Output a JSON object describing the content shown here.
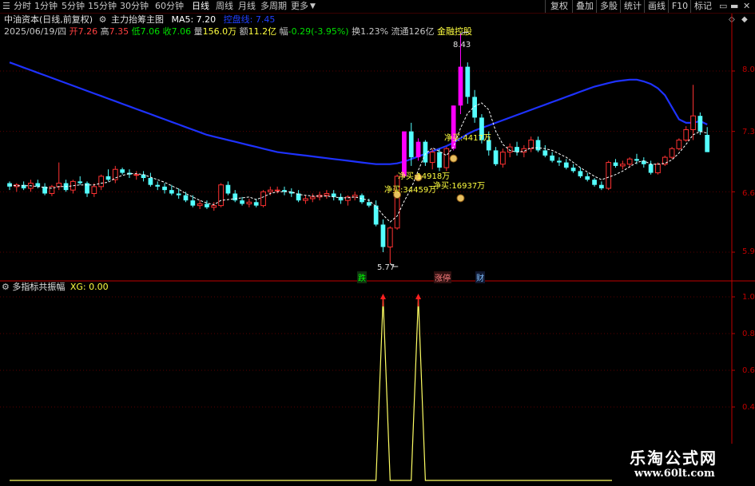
{
  "toolbar": {
    "menu_icon": "menu-icon",
    "periods": [
      "分时",
      "1分钟",
      "5分钟",
      "15分钟",
      "30分钟",
      "60分钟",
      "日线",
      "周线",
      "月线",
      "多周期",
      "更多"
    ],
    "active_period": "日线",
    "more_arrow": "chevron-down-icon",
    "right_buttons": [
      "复权",
      "叠加",
      "多股",
      "统计",
      "画线",
      "F10",
      "标记"
    ],
    "right_icons": [
      "layout-icon",
      "minimize-icon",
      "close-icon"
    ]
  },
  "info": {
    "stock_title": "中油资本(日线,前复权)",
    "indicator_name": "主力抬筹主图",
    "ma_label": "MA5: 7.20",
    "ma_hidden": "控盘线: 7.45",
    "date": "2025/06/19/四",
    "open_label": "开",
    "open_val": "7.26",
    "high_label": "高",
    "high_val": "7.35",
    "low_label": "低",
    "low_val": "7.06",
    "close_label": "收",
    "close_val": "7.06",
    "vol_label": "量",
    "vol_val": "156.0万",
    "amt_label": "额",
    "amt_val": "11.2亿",
    "chg_label": "幅",
    "chg_val": "-0.29(-3.95%)",
    "turn_label": "换",
    "turn_val": "1.23%",
    "float_label": "流通",
    "float_val": "126亿",
    "tag": "金融控股"
  },
  "main_axis": [
    "8.0",
    "7.3",
    "6.6",
    "5.9"
  ],
  "sub_axis": [
    "1.0",
    "0.80",
    "0.60",
    "0.40"
  ],
  "annotations": {
    "high_price": "8.43",
    "low_price": "5.77",
    "net_buy_1": "净买:4417万",
    "net_buy_2": "净买:14918万",
    "net_buy_3": "净买:34459万",
    "net_buy_4": "净买:16937万",
    "mark_drop": "跌",
    "mark_limit_up": "涨停",
    "mark_fin": "财"
  },
  "sub_panel": {
    "title": "多指标共振幅",
    "xg_label": "XG: 0.00"
  },
  "watermark": {
    "logo": "乐淘公式网",
    "url": "www.60lt.com"
  },
  "chart_data": {
    "type": "line",
    "title": "",
    "ylim": [
      5.7,
      8.6
    ],
    "candles": [
      [
        6.7,
        6.72,
        6.62,
        6.66
      ],
      [
        6.66,
        6.7,
        6.6,
        6.68
      ],
      [
        6.68,
        6.72,
        6.62,
        6.64
      ],
      [
        6.64,
        6.74,
        6.6,
        6.7
      ],
      [
        6.7,
        6.74,
        6.64,
        6.66
      ],
      [
        6.66,
        6.7,
        6.56,
        6.58
      ],
      [
        6.58,
        6.68,
        6.55,
        6.66
      ],
      [
        6.66,
        6.94,
        6.62,
        6.7
      ],
      [
        6.7,
        6.74,
        6.6,
        6.62
      ],
      [
        6.62,
        6.74,
        6.58,
        6.72
      ],
      [
        6.72,
        6.78,
        6.68,
        6.7
      ],
      [
        6.7,
        6.72,
        6.54,
        6.58
      ],
      [
        6.58,
        6.7,
        6.54,
        6.66
      ],
      [
        6.66,
        6.8,
        6.62,
        6.78
      ],
      [
        6.78,
        6.86,
        6.72,
        6.74
      ],
      [
        6.74,
        6.9,
        6.7,
        6.86
      ],
      [
        6.86,
        6.88,
        6.8,
        6.82
      ],
      [
        6.82,
        6.86,
        6.76,
        6.8
      ],
      [
        6.8,
        6.84,
        6.74,
        6.8
      ],
      [
        6.8,
        6.84,
        6.72,
        6.76
      ],
      [
        6.76,
        6.82,
        6.66,
        6.68
      ],
      [
        6.68,
        6.72,
        6.62,
        6.66
      ],
      [
        6.66,
        6.7,
        6.58,
        6.62
      ],
      [
        6.62,
        6.68,
        6.56,
        6.58
      ],
      [
        6.58,
        6.64,
        6.52,
        6.56
      ],
      [
        6.56,
        6.6,
        6.48,
        6.5
      ],
      [
        6.5,
        6.56,
        6.42,
        6.44
      ],
      [
        6.44,
        6.5,
        6.4,
        6.46
      ],
      [
        6.46,
        6.5,
        6.4,
        6.42
      ],
      [
        6.42,
        6.48,
        6.38,
        6.44
      ],
      [
        6.44,
        6.7,
        6.42,
        6.68
      ],
      [
        6.68,
        6.72,
        6.56,
        6.58
      ],
      [
        6.58,
        6.62,
        6.48,
        6.5
      ],
      [
        6.5,
        6.54,
        6.44,
        6.46
      ],
      [
        6.46,
        6.52,
        6.42,
        6.48
      ],
      [
        6.48,
        6.52,
        6.42,
        6.44
      ],
      [
        6.44,
        6.62,
        6.42,
        6.6
      ],
      [
        6.6,
        6.66,
        6.56,
        6.62
      ],
      [
        6.62,
        6.66,
        6.58,
        6.62
      ],
      [
        6.62,
        6.66,
        6.56,
        6.6
      ],
      [
        6.6,
        6.64,
        6.54,
        6.58
      ],
      [
        6.58,
        6.62,
        6.48,
        6.5
      ],
      [
        6.5,
        6.56,
        6.46,
        6.52
      ],
      [
        6.52,
        6.58,
        6.48,
        6.54
      ],
      [
        6.54,
        6.6,
        6.5,
        6.56
      ],
      [
        6.56,
        6.62,
        6.52,
        6.58
      ],
      [
        6.58,
        6.62,
        6.5,
        6.54
      ],
      [
        6.54,
        6.58,
        6.46,
        6.5
      ],
      [
        6.5,
        6.56,
        6.44,
        6.54
      ],
      [
        6.54,
        6.6,
        6.5,
        6.56
      ],
      [
        6.56,
        6.58,
        6.46,
        6.48
      ],
      [
        6.48,
        6.52,
        6.42,
        6.44
      ],
      [
        6.44,
        6.5,
        6.2,
        6.22
      ],
      [
        6.22,
        6.28,
        5.9,
        5.96
      ],
      [
        5.96,
        6.2,
        5.77,
        6.18
      ],
      [
        6.18,
        6.8,
        6.16,
        6.78
      ],
      [
        6.78,
        7.3,
        6.76,
        7.3
      ],
      [
        7.3,
        7.4,
        6.9,
        7.0
      ],
      [
        7.0,
        7.22,
        6.96,
        7.18
      ],
      [
        7.18,
        7.2,
        6.9,
        6.94
      ],
      [
        6.94,
        7.1,
        6.86,
        7.06
      ],
      [
        7.06,
        7.1,
        6.84,
        6.88
      ],
      [
        6.88,
        7.12,
        6.84,
        7.1
      ],
      [
        7.1,
        7.6,
        7.08,
        7.6
      ],
      [
        7.6,
        8.43,
        7.5,
        8.05
      ],
      [
        8.05,
        8.1,
        7.62,
        7.7
      ],
      [
        7.7,
        7.78,
        7.4,
        7.46
      ],
      [
        7.46,
        7.5,
        7.16,
        7.2
      ],
      [
        7.2,
        7.3,
        7.02,
        7.08
      ],
      [
        7.08,
        7.12,
        6.9,
        6.92
      ],
      [
        6.92,
        7.1,
        6.88,
        7.06
      ],
      [
        7.06,
        7.16,
        7.0,
        7.12
      ],
      [
        7.12,
        7.18,
        7.02,
        7.06
      ],
      [
        7.06,
        7.14,
        7.0,
        7.1
      ],
      [
        7.1,
        7.24,
        7.06,
        7.2
      ],
      [
        7.2,
        7.24,
        7.06,
        7.08
      ],
      [
        7.08,
        7.14,
        7.0,
        7.02
      ],
      [
        7.02,
        7.06,
        6.94,
        6.96
      ],
      [
        6.96,
        7.0,
        6.9,
        6.94
      ],
      [
        6.94,
        6.98,
        6.86,
        6.88
      ],
      [
        6.88,
        6.92,
        6.82,
        6.84
      ],
      [
        6.84,
        6.88,
        6.76,
        6.78
      ],
      [
        6.78,
        6.82,
        6.72,
        6.74
      ],
      [
        6.74,
        6.76,
        6.66,
        6.68
      ],
      [
        6.68,
        6.72,
        6.62,
        6.64
      ],
      [
        6.64,
        6.96,
        6.62,
        6.94
      ],
      [
        6.94,
        6.98,
        6.88,
        6.9
      ],
      [
        6.9,
        6.96,
        6.86,
        6.92
      ],
      [
        6.92,
        7.0,
        6.88,
        6.98
      ],
      [
        6.98,
        7.04,
        6.92,
        6.96
      ],
      [
        6.96,
        7.0,
        6.88,
        6.92
      ],
      [
        6.92,
        6.96,
        6.8,
        6.82
      ],
      [
        6.82,
        6.94,
        6.8,
        6.92
      ],
      [
        6.92,
        7.02,
        6.9,
        7.0
      ],
      [
        7.0,
        7.12,
        6.98,
        7.1
      ],
      [
        7.1,
        7.22,
        7.08,
        7.2
      ],
      [
        7.2,
        7.36,
        7.18,
        7.32
      ],
      [
        7.32,
        7.84,
        7.2,
        7.48
      ],
      [
        7.48,
        7.52,
        7.26,
        7.3
      ],
      [
        7.26,
        7.35,
        7.06,
        7.06
      ]
    ],
    "ma5": [
      6.68,
      6.67,
      6.67,
      6.67,
      6.66,
      6.65,
      6.64,
      6.66,
      6.66,
      6.67,
      6.68,
      6.68,
      6.68,
      6.7,
      6.71,
      6.76,
      6.79,
      6.81,
      6.81,
      6.8,
      6.77,
      6.74,
      6.71,
      6.67,
      6.63,
      6.58,
      6.54,
      6.5,
      6.47,
      6.45,
      6.5,
      6.51,
      6.52,
      6.53,
      6.54,
      6.51,
      6.54,
      6.58,
      6.6,
      6.6,
      6.6,
      6.57,
      6.56,
      6.55,
      6.55,
      6.55,
      6.54,
      6.53,
      6.53,
      6.54,
      6.52,
      6.5,
      6.43,
      6.33,
      6.25,
      6.32,
      6.49,
      6.64,
      6.85,
      7.04,
      7.11,
      7.07,
      7.02,
      7.12,
      7.34,
      7.51,
      7.59,
      7.63,
      7.55,
      7.3,
      7.15,
      7.08,
      7.06,
      7.07,
      7.11,
      7.11,
      7.1,
      7.08,
      7.04,
      7.0,
      6.94,
      6.88,
      6.83,
      6.78,
      6.74,
      6.77,
      6.8,
      6.84,
      6.89,
      6.94,
      6.96,
      6.92,
      6.92,
      6.93,
      6.97,
      7.05,
      7.15,
      7.26,
      7.3,
      7.28
    ],
    "control_line": [
      8.1,
      8.07,
      8.04,
      8.01,
      7.98,
      7.95,
      7.92,
      7.89,
      7.86,
      7.83,
      7.8,
      7.77,
      7.74,
      7.71,
      7.68,
      7.65,
      7.62,
      7.59,
      7.56,
      7.53,
      7.5,
      7.47,
      7.44,
      7.41,
      7.38,
      7.35,
      7.32,
      7.29,
      7.26,
      7.24,
      7.22,
      7.2,
      7.18,
      7.16,
      7.14,
      7.12,
      7.1,
      7.08,
      7.06,
      7.05,
      7.04,
      7.03,
      7.02,
      7.01,
      7.0,
      6.99,
      6.98,
      6.97,
      6.96,
      6.95,
      6.94,
      6.93,
      6.92,
      6.92,
      6.92,
      6.93,
      6.95,
      6.98,
      7.01,
      7.04,
      7.07,
      7.1,
      7.13,
      7.17,
      7.22,
      7.27,
      7.31,
      7.34,
      7.37,
      7.4,
      7.43,
      7.46,
      7.49,
      7.52,
      7.55,
      7.58,
      7.61,
      7.64,
      7.67,
      7.7,
      7.73,
      7.76,
      7.79,
      7.82,
      7.84,
      7.86,
      7.88,
      7.89,
      7.9,
      7.9,
      7.88,
      7.85,
      7.8,
      7.72,
      7.58,
      7.44,
      7.4,
      7.4,
      7.42,
      7.38
    ],
    "xg": [
      0,
      0,
      0,
      0,
      0,
      0,
      0,
      0,
      0,
      0,
      0,
      0,
      0,
      0,
      0,
      0,
      0,
      0,
      0,
      0,
      0,
      0,
      0,
      0,
      0,
      0,
      0,
      0,
      0,
      0,
      0,
      0,
      0,
      0,
      0,
      0,
      0,
      0,
      0,
      0,
      0,
      0,
      0,
      0,
      0,
      0,
      0,
      0,
      0,
      0,
      0,
      0,
      0,
      1,
      0,
      0,
      0,
      0,
      1,
      0,
      0,
      0,
      0,
      0,
      0,
      0,
      0,
      0,
      0,
      0,
      0,
      0,
      0,
      0,
      0,
      0,
      0,
      0,
      0,
      0,
      0,
      0,
      0,
      0,
      0,
      0,
      0,
      0,
      0,
      0,
      0,
      0,
      0,
      0,
      0,
      0,
      0,
      0,
      0,
      0
    ],
    "sub_ylim": [
      0,
      1.0
    ],
    "colors": {
      "up": "#ff3232",
      "down": "#54ffff",
      "magenta": "#ff00ff",
      "control_line": "#1e32ff",
      "ma5": "#ffffff",
      "xg": "#ffff64",
      "grid": "#5a0000",
      "axis": "#c00000"
    }
  }
}
